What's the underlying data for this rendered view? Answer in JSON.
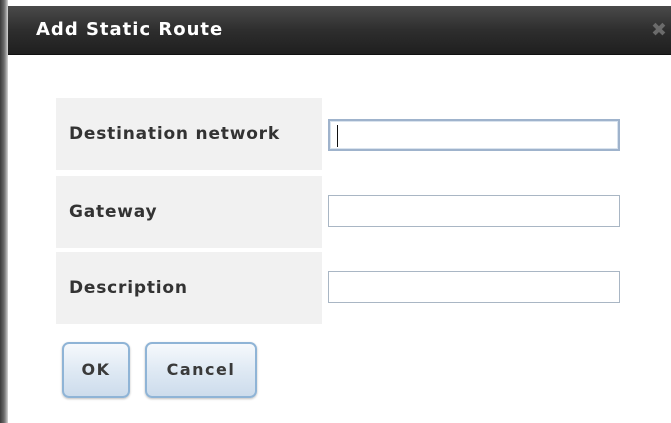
{
  "dialog": {
    "title": "Add Static Route",
    "close_icon": "close-icon"
  },
  "form": {
    "fields": [
      {
        "label": "Destination network",
        "value": "",
        "placeholder": ""
      },
      {
        "label": "Gateway",
        "value": "",
        "placeholder": ""
      },
      {
        "label": "Description",
        "value": "",
        "placeholder": ""
      }
    ]
  },
  "buttons": {
    "ok_label": "OK",
    "cancel_label": "Cancel"
  },
  "colors": {
    "titlebar": "#2e2e2e",
    "label_bg": "#f1f1f1",
    "button_border": "#8fb4d6"
  }
}
